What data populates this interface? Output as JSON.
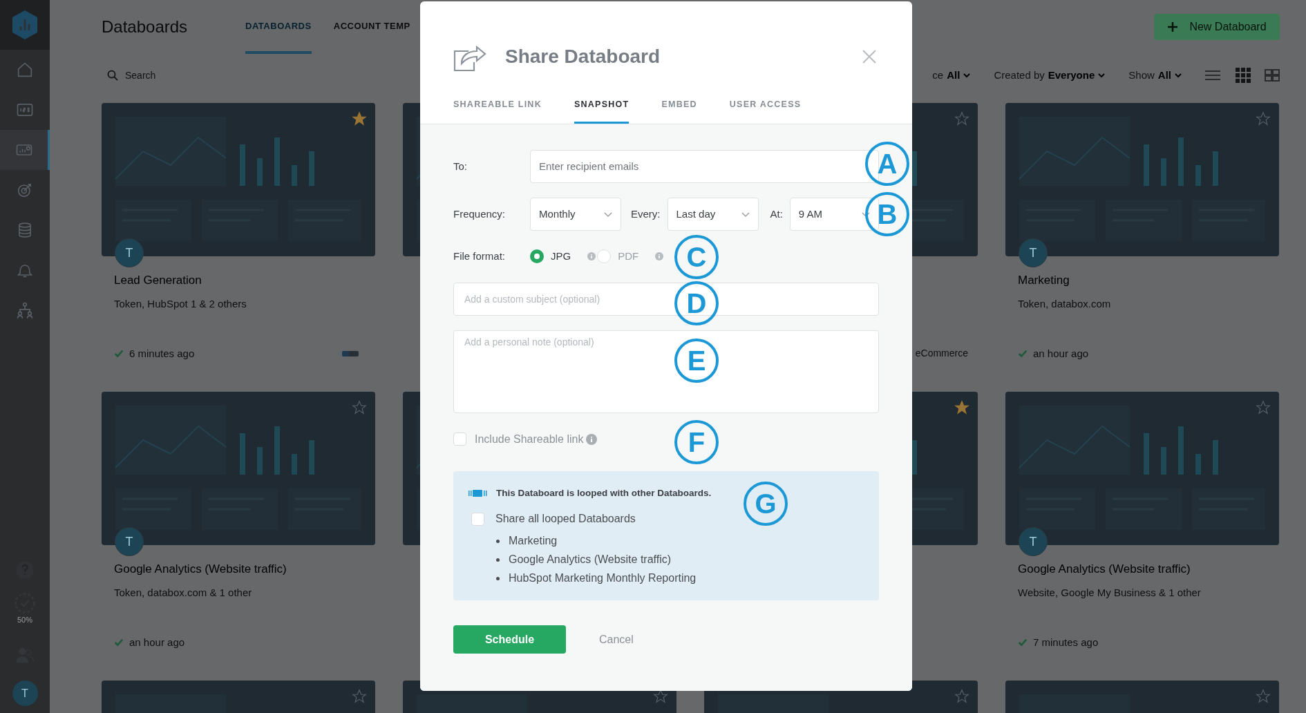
{
  "sidebar": {
    "items": [
      {
        "kind": "home",
        "selected": false
      },
      {
        "kind": "numbers",
        "selected": false
      },
      {
        "kind": "dashboard",
        "selected": true
      },
      {
        "kind": "goal",
        "selected": false
      },
      {
        "kind": "data",
        "selected": false
      },
      {
        "kind": "alert",
        "selected": false
      },
      {
        "kind": "team",
        "selected": false
      }
    ],
    "progress": "50%",
    "avatar": "T"
  },
  "header": {
    "title": "Databoards",
    "tabs": [
      {
        "label": "DATABOARDS",
        "selected": true
      },
      {
        "label": "ACCOUNT TEMP",
        "selected": false
      }
    ],
    "new_button": "New Databoard"
  },
  "toolbar": {
    "search_placeholder": "Search",
    "filters": [
      {
        "label": "ce",
        "value": "All"
      },
      {
        "label": "Created by",
        "value": "Everyone"
      },
      {
        "label": "Show",
        "value": "All"
      }
    ]
  },
  "cards": [
    {
      "kind": "card",
      "title": "Lead Generation",
      "subtitle": "Token, HubSpot 1 & 2 others",
      "time": "6 minutes ago",
      "avatar": "T",
      "favorite": true,
      "looped": true
    },
    {
      "kind": "thumbnail"
    },
    {
      "kind": "card",
      "favorite": false,
      "tag": "eCommerce"
    },
    {
      "kind": "card",
      "title": "Marketing",
      "subtitle": "Token, databox.com",
      "time": "an hour ago",
      "avatar": "T",
      "favorite": false
    },
    {
      "kind": "card",
      "title": "Google Analytics (Website traffic)",
      "subtitle": "Token, databox.com & 1 other",
      "time": "an hour ago",
      "avatar": "T",
      "favorite": false
    },
    {
      "kind": "thumbnail"
    },
    {
      "kind": "card",
      "favorite": true
    },
    {
      "kind": "card",
      "title": "Google Analytics (Website traffic)",
      "subtitle": "Website, Google My Business & 1 other",
      "time": "7 minutes ago",
      "avatar": "T",
      "favorite": false
    },
    {
      "kind": "card",
      "favorite": false
    },
    {
      "kind": "card",
      "favorite": false
    },
    {
      "kind": "card",
      "favorite": false
    },
    {
      "kind": "card",
      "favorite": false
    }
  ],
  "modal": {
    "title": "Share Databoard",
    "tabs": [
      {
        "label": "SHAREABLE LINK",
        "selected": false
      },
      {
        "label": "SNAPSHOT",
        "selected": true
      },
      {
        "label": "EMBED",
        "selected": false
      },
      {
        "label": "USER ACCESS",
        "selected": false
      }
    ],
    "to_label": "To:",
    "to_placeholder": "Enter recipient emails",
    "frequency_label": "Frequency:",
    "frequency": "Monthly",
    "every_label": "Every:",
    "every": "Last day",
    "at_label": "At:",
    "at": "9 AM",
    "file_format_label": "File format:",
    "formats": [
      {
        "label": "JPG",
        "selected": true
      },
      {
        "label": "PDF",
        "selected": false
      }
    ],
    "subject_placeholder": "Add a custom subject (optional)",
    "note_placeholder": "Add a personal note (optional)",
    "include_link": {
      "label": "Include Shareable link",
      "checked": false
    },
    "loop": {
      "message": "This Databoard is looped with other Databoards.",
      "share_all": {
        "label": "Share all looped Databoards",
        "checked": false
      },
      "databoards": [
        "Marketing",
        "Google Analytics (Website traffic)",
        "HubSpot Marketing Monthly Reporting"
      ]
    },
    "schedule_button": "Schedule",
    "cancel_button": "Cancel"
  },
  "annotations": [
    "A",
    "B",
    "C",
    "D",
    "E",
    "F",
    "G"
  ]
}
